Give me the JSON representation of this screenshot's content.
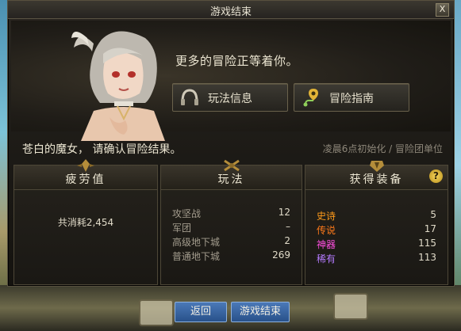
{
  "window": {
    "title": "游戏结束",
    "close_label": "X"
  },
  "top": {
    "prompt": "更多的冒险正等着你。",
    "buttons": [
      {
        "label": "玩法信息",
        "icon": "headphones-icon"
      },
      {
        "label": "冒险指南",
        "icon": "map-pin-route-icon"
      }
    ]
  },
  "info": {
    "confirm_text": "苍白的魔女，   请确认冒险结果。",
    "reset_info": "凌晨6点初始化 / 冒险团单位"
  },
  "fatigue": {
    "title": "疲劳值",
    "consumed": "共消耗2,454"
  },
  "gameplay": {
    "title": "玩法",
    "rows": [
      {
        "label": "攻坚战",
        "value": "12"
      },
      {
        "label": "军团",
        "value": "–"
      },
      {
        "label": "高级地下城",
        "value": "2"
      },
      {
        "label": "普通地下城",
        "value": "269"
      }
    ]
  },
  "equipment": {
    "title": "获得装备",
    "help_label": "?",
    "rows": [
      {
        "label": "史诗",
        "value": "5",
        "color": "#ff9b1a"
      },
      {
        "label": "传说",
        "value": "17",
        "color": "#ff7a1a"
      },
      {
        "label": "神器",
        "value": "115",
        "color": "#ff4fe0"
      },
      {
        "label": "稀有",
        "value": "113",
        "color": "#b57bff"
      }
    ]
  },
  "bottom": {
    "back_label": "返回",
    "end_label": "游戏结束"
  },
  "colors": {
    "accent_gold": "#c9a24a",
    "label_gray": "#a39c8d"
  }
}
